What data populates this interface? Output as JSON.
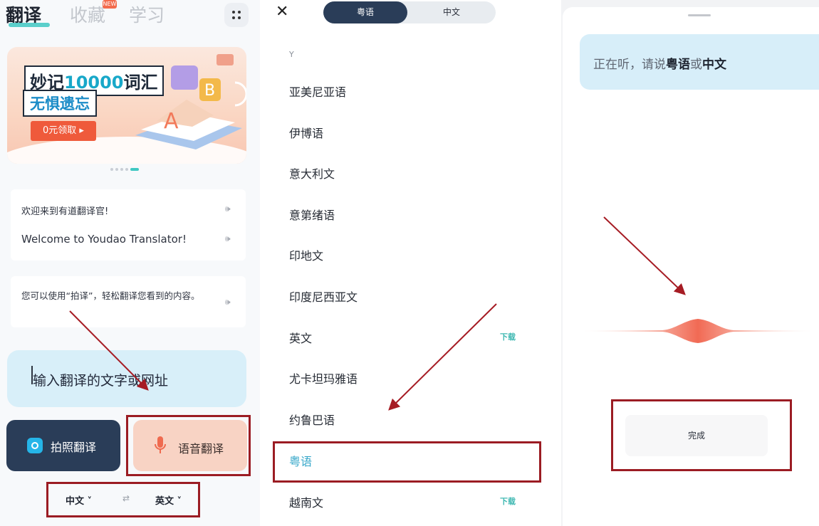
{
  "screen_home": {
    "tabs": [
      "翻译",
      "收藏",
      "学习"
    ],
    "fav_badge": "NEW",
    "grid_icon": "grid-dots-icon",
    "banner": {
      "title_prefix": "妙记",
      "title_number": "10000",
      "title_suffix": "词汇",
      "subtitle": "无惧遗忘",
      "cta": "0元领取 ▸"
    },
    "card_1": {
      "zh": "欢迎来到有道翻译官!",
      "en": "Welcome to Youdao Translator!",
      "speaker": "🕪"
    },
    "card_2": {
      "text": "您可以使用“拍译”，轻松翻译您看到的内容。",
      "speaker": "🕪"
    },
    "input_placeholder": "输入翻译的文字或网址",
    "photo_button": "拍照翻译",
    "voice_button": "语音翻译",
    "lang_from": "中文 ˅",
    "swap": "⇄",
    "lang_to": "英文 ˅"
  },
  "screen_langs": {
    "close": "✕",
    "seg_active": "粤语",
    "seg_other": "中文",
    "section": "Y",
    "items": [
      {
        "name": "亚美尼亚语",
        "tag": ""
      },
      {
        "name": "伊博语",
        "tag": ""
      },
      {
        "name": "意大利文",
        "tag": ""
      },
      {
        "name": "意第绪语",
        "tag": ""
      },
      {
        "name": "印地文",
        "tag": ""
      },
      {
        "name": "印度尼西亚文",
        "tag": ""
      },
      {
        "name": "英文",
        "tag": "下载"
      },
      {
        "name": "尤卡坦玛雅语",
        "tag": ""
      },
      {
        "name": "约鲁巴语",
        "tag": ""
      },
      {
        "name": "粤语",
        "tag": ""
      },
      {
        "name": "越南文",
        "tag": "下载"
      }
    ],
    "selected_index": 9
  },
  "screen_listen": {
    "prefix": "正在听，请说",
    "lang_a": "粤语",
    "joiner": "或",
    "lang_b": "中文",
    "done": "完成"
  },
  "colors": {
    "accent_teal": "#3fc8c2",
    "navy": "#2a3d58",
    "highlight_red": "#9b1c23",
    "voice_peach": "#f8d3c4"
  }
}
